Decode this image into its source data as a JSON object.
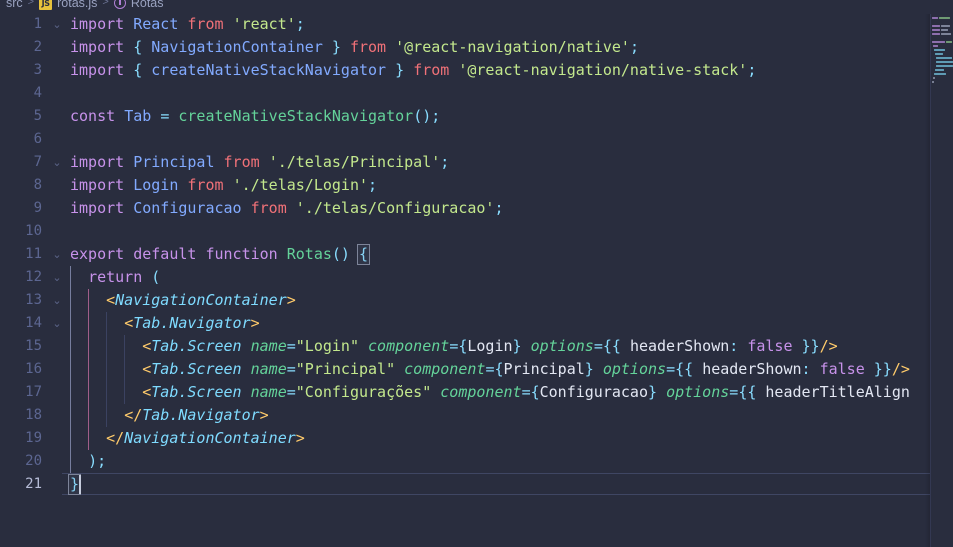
{
  "breadcrumb": {
    "root": "src",
    "separator": ">",
    "file_icon": "JS",
    "file": "rotas.js",
    "symbol_icon": "symbol-misc-icon",
    "symbol": "Rotas"
  },
  "editor": {
    "language": "javascript",
    "theme": "Material Palenight",
    "total_lines": 21,
    "cursor_line": 21,
    "colors": {
      "background": "#292d3e",
      "line_number": "#5c6691",
      "line_number_active": "#b7bdd8",
      "keyword": "#c792ea",
      "keyword_from": "#f07178",
      "string": "#c3e88d",
      "variable": "#82aaff",
      "function_green": "#64d39a",
      "punctuation": "#89ddff",
      "jsx_tag": "#7fdbff",
      "jsx_attribute": "#64d39a",
      "jsx_angle": "#ffcb6b",
      "boolean": "#c792ea",
      "plain_text": "#bec5db"
    },
    "lines": [
      {
        "n": "1",
        "fold": "chevron-down",
        "text": "import React from 'react';"
      },
      {
        "n": "2",
        "fold": "",
        "text": "import { NavigationContainer } from '@react-navigation/native';"
      },
      {
        "n": "3",
        "fold": "",
        "text": "import { createNativeStackNavigator } from '@react-navigation/native-stack';"
      },
      {
        "n": "4",
        "fold": "",
        "text": ""
      },
      {
        "n": "5",
        "fold": "",
        "text": "const Tab = createNativeStackNavigator();"
      },
      {
        "n": "6",
        "fold": "",
        "text": ""
      },
      {
        "n": "7",
        "fold": "chevron-down",
        "text": "import Principal from './telas/Principal';"
      },
      {
        "n": "8",
        "fold": "",
        "text": "import Login from './telas/Login';"
      },
      {
        "n": "9",
        "fold": "",
        "text": "import Configuracao from './telas/Configuracao';"
      },
      {
        "n": "10",
        "fold": "",
        "text": ""
      },
      {
        "n": "11",
        "fold": "chevron-down",
        "text": "export default function Rotas() {"
      },
      {
        "n": "12",
        "fold": "chevron-down",
        "text": "  return ("
      },
      {
        "n": "13",
        "fold": "chevron-down",
        "text": "    <NavigationContainer>"
      },
      {
        "n": "14",
        "fold": "chevron-down",
        "text": "      <Tab.Navigator>"
      },
      {
        "n": "15",
        "fold": "",
        "text": "        <Tab.Screen name=\"Login\" component={Login} options={{ headerShown: false }}/>"
      },
      {
        "n": "16",
        "fold": "",
        "text": "        <Tab.Screen name=\"Principal\" component={Principal} options={{ headerShown: false }}/>"
      },
      {
        "n": "17",
        "fold": "",
        "text": "        <Tab.Screen name=\"Configurações\" component={Configuracao} options={{ headerTitleAlign"
      },
      {
        "n": "18",
        "fold": "",
        "text": "      </Tab.Navigator>"
      },
      {
        "n": "19",
        "fold": "",
        "text": "    </NavigationContainer>"
      },
      {
        "n": "20",
        "fold": "",
        "text": "  );"
      },
      {
        "n": "21",
        "fold": "",
        "text": "}"
      }
    ]
  },
  "minimap": {
    "name": "minimap",
    "rows": [
      [
        {
          "x": 1,
          "w": 9,
          "c": "#8d6fae"
        },
        {
          "x": 11,
          "w": 6,
          "c": "#7d8499"
        }
      ],
      [
        {
          "x": 1,
          "w": 8,
          "c": "#8d6fae"
        },
        {
          "x": 10,
          "w": 11,
          "c": "#7d8499"
        }
      ],
      [
        {
          "x": 1,
          "w": 8,
          "c": "#8d6fae"
        },
        {
          "x": 10,
          "w": 12,
          "c": "#7d8499"
        }
      ],
      [],
      [
        {
          "x": 1,
          "w": 6,
          "c": "#8d6fae"
        },
        {
          "x": 8,
          "w": 11,
          "c": "#6f9a73"
        }
      ],
      [],
      [
        {
          "x": 1,
          "w": 8,
          "c": "#8d6fae"
        },
        {
          "x": 10,
          "w": 9,
          "c": "#7d8499"
        }
      ],
      [
        {
          "x": 1,
          "w": 8,
          "c": "#8d6fae"
        },
        {
          "x": 10,
          "w": 7,
          "c": "#7d8499"
        }
      ],
      [
        {
          "x": 1,
          "w": 8,
          "c": "#8d6fae"
        },
        {
          "x": 10,
          "w": 10,
          "c": "#7d8499"
        }
      ],
      [],
      [
        {
          "x": 1,
          "w": 13,
          "c": "#8d6fae"
        },
        {
          "x": 15,
          "w": 6,
          "c": "#6f9a73"
        }
      ],
      [
        {
          "x": 2,
          "w": 5,
          "c": "#8d6fae"
        }
      ],
      [
        {
          "x": 3,
          "w": 11,
          "c": "#5f9cb5"
        }
      ],
      [
        {
          "x": 4,
          "w": 8,
          "c": "#5f9cb5"
        }
      ],
      [
        {
          "x": 5,
          "w": 16,
          "c": "#5f9cb5"
        }
      ],
      [
        {
          "x": 5,
          "w": 17,
          "c": "#5f9cb5"
        }
      ],
      [
        {
          "x": 5,
          "w": 17,
          "c": "#5f9cb5"
        }
      ],
      [
        {
          "x": 4,
          "w": 9,
          "c": "#5f9cb5"
        }
      ],
      [
        {
          "x": 3,
          "w": 12,
          "c": "#5f9cb5"
        }
      ],
      [
        {
          "x": 2,
          "w": 2,
          "c": "#7d8499"
        }
      ],
      [
        {
          "x": 1,
          "w": 2,
          "c": "#7d8499"
        }
      ]
    ]
  }
}
